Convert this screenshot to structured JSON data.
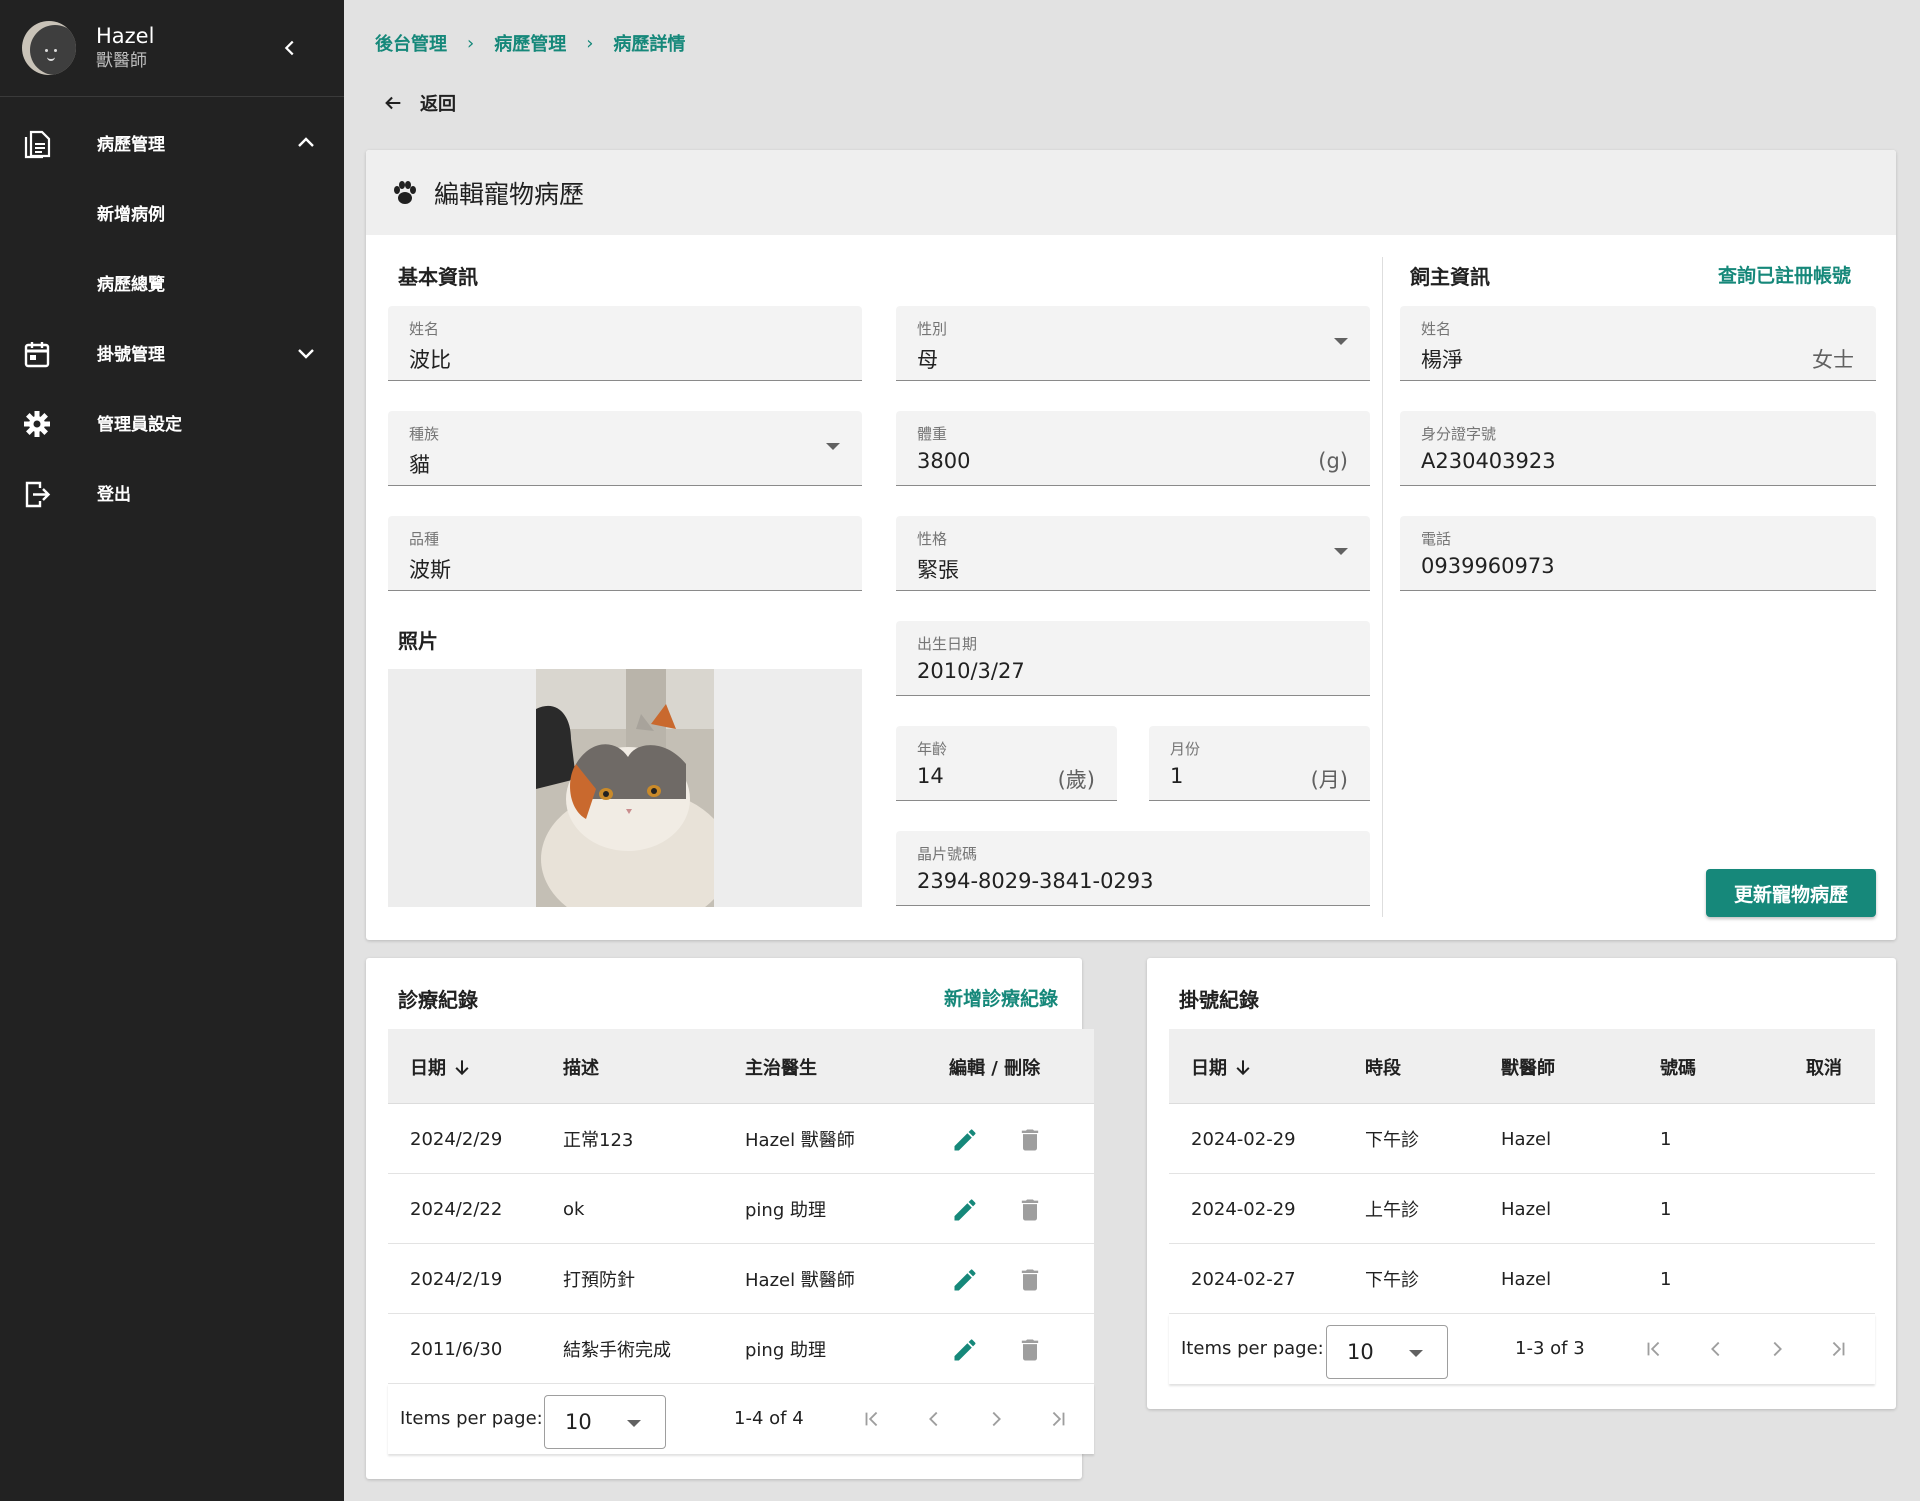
{
  "sidebar": {
    "user": {
      "name": "Hazel",
      "role": "獸醫師"
    },
    "items": [
      {
        "label": "病歷管理",
        "icon": "document-icon",
        "expanded": true
      },
      {
        "label": "新增病例"
      },
      {
        "label": "病歷總覽"
      },
      {
        "label": "掛號管理",
        "icon": "calendar-icon",
        "expanded": false
      },
      {
        "label": "管理員設定",
        "icon": "gear-icon"
      },
      {
        "label": "登出",
        "icon": "logout-icon"
      }
    ]
  },
  "breadcrumb": [
    "後台管理",
    "病歷管理",
    "病歷詳情"
  ],
  "back_label": "返回",
  "edit": {
    "title": "編輯寵物病歷",
    "basic_title": "基本資訊",
    "owner_title": "飼主資訊",
    "owner_link": "查詢已註冊帳號",
    "photo_title": "照片",
    "fields": {
      "name": {
        "label": "姓名",
        "value": "波比"
      },
      "gender": {
        "label": "性別",
        "value": "母"
      },
      "species": {
        "label": "種族",
        "value": "貓"
      },
      "weight": {
        "label": "體重",
        "value": "3800",
        "suffix": "(g)"
      },
      "breed": {
        "label": "品種",
        "value": "波斯"
      },
      "temper": {
        "label": "性格",
        "value": "緊張"
      },
      "birth": {
        "label": "出生日期",
        "value": "2010/3/27"
      },
      "age_years": {
        "label": "年齡",
        "value": "14",
        "suffix": "(歲)"
      },
      "age_months": {
        "label": "月份",
        "value": "1",
        "suffix": "(月)"
      },
      "chip": {
        "label": "晶片號碼",
        "value": "2394-8029-3841-0293"
      },
      "owner_name": {
        "label": "姓名",
        "value": "楊淨",
        "suffix": "女士"
      },
      "owner_id": {
        "label": "身分證字號",
        "value": "A230403923"
      },
      "owner_phone": {
        "label": "電話",
        "value": "0939960973"
      }
    },
    "update_button": "更新寵物病歷"
  },
  "records": {
    "title": "診療紀錄",
    "add_link": "新增診療紀錄",
    "headers": [
      "日期",
      "描述",
      "主治醫生",
      "編輯 / 刪除"
    ],
    "rows": [
      {
        "date": "2024/2/29",
        "desc": "正常123",
        "doctor": "Hazel 獸醫師"
      },
      {
        "date": "2024/2/22",
        "desc": "ok",
        "doctor": "ping 助理"
      },
      {
        "date": "2024/2/19",
        "desc": "打預防針",
        "doctor": "Hazel 獸醫師"
      },
      {
        "date": "2011/6/30",
        "desc": "結紮手術完成",
        "doctor": "ping 助理"
      }
    ],
    "footer": {
      "items_per_page_label": "Items per page:",
      "items_per_page": "10",
      "range": "1-4 of 4"
    }
  },
  "registrations": {
    "title": "掛號紀錄",
    "headers": [
      "日期",
      "時段",
      "獸醫師",
      "號碼",
      "取消"
    ],
    "rows": [
      {
        "date": "2024-02-29",
        "slot": "下午診",
        "vet": "Hazel",
        "num": "1"
      },
      {
        "date": "2024-02-29",
        "slot": "上午診",
        "vet": "Hazel",
        "num": "1"
      },
      {
        "date": "2024-02-27",
        "slot": "下午診",
        "vet": "Hazel",
        "num": "1"
      }
    ],
    "footer": {
      "items_per_page_label": "Items per page:",
      "items_per_page": "10",
      "range": "1-3 of 3"
    }
  },
  "colors": {
    "accent": "#16887a",
    "sidebar": "#222222",
    "background": "#e2e2e2"
  }
}
